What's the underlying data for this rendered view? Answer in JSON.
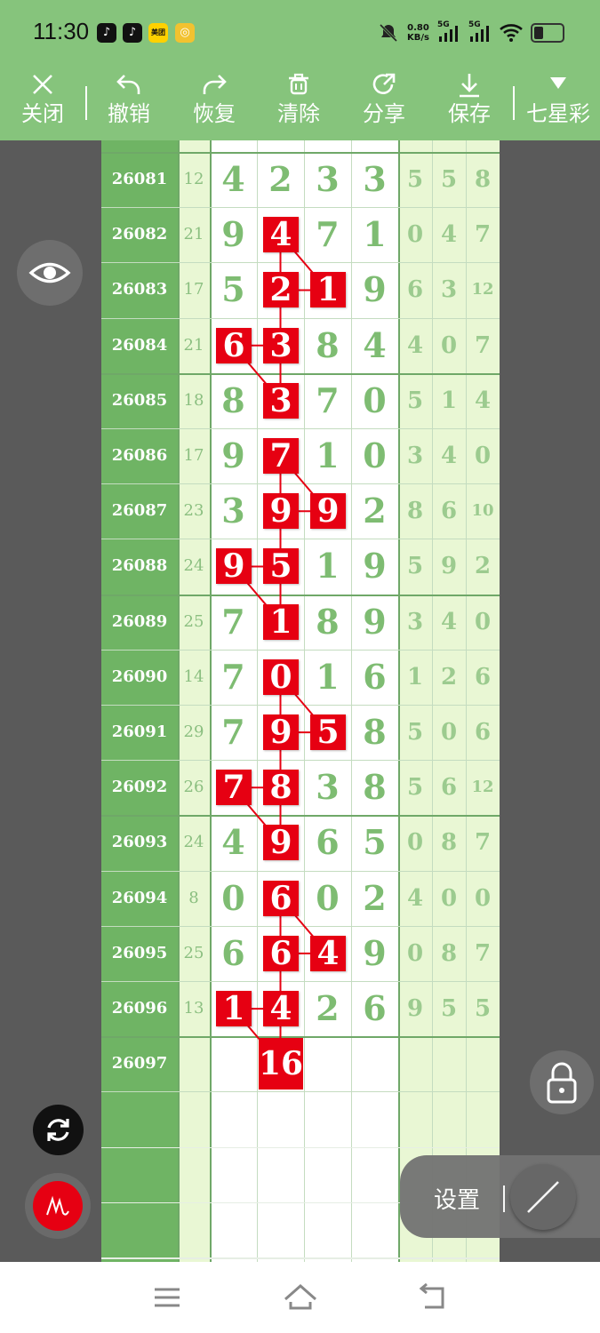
{
  "status_bar": {
    "time": "11:30",
    "app_icons": [
      "tiktok-icon",
      "tiktok-icon",
      "meituan-icon",
      "notification-icon"
    ],
    "meituan_label": "美团",
    "net_speed_value": "0.80",
    "net_speed_unit": "KB/s",
    "signal_1": "5G",
    "signal_2": "5G"
  },
  "toolbar": {
    "items": [
      {
        "label": "关闭",
        "icon": "close-icon"
      },
      {
        "label": "撤销",
        "icon": "undo-icon"
      },
      {
        "label": "恢复",
        "icon": "redo-icon"
      },
      {
        "label": "清除",
        "icon": "trash-icon"
      },
      {
        "label": "分享",
        "icon": "share-icon"
      },
      {
        "label": "保存",
        "icon": "download-icon"
      },
      {
        "label": "七星彩",
        "icon": "dropdown-triangle-icon"
      }
    ]
  },
  "chart": {
    "rows": [
      {
        "id": "26081",
        "sum": "12",
        "digits": [
          "4",
          "2",
          "3",
          "3"
        ],
        "tails": [
          "5",
          "5",
          "8"
        ]
      },
      {
        "id": "26082",
        "sum": "21",
        "digits": [
          "9",
          "4",
          "7",
          "1"
        ],
        "tails": [
          "0",
          "4",
          "7"
        ]
      },
      {
        "id": "26083",
        "sum": "17",
        "digits": [
          "5",
          "2",
          "1",
          "9"
        ],
        "tails": [
          "6",
          "3",
          "12"
        ]
      },
      {
        "id": "26084",
        "sum": "21",
        "digits": [
          "6",
          "3",
          "8",
          "4"
        ],
        "tails": [
          "4",
          "0",
          "7"
        ]
      },
      {
        "id": "26085",
        "sum": "18",
        "digits": [
          "8",
          "3",
          "7",
          "0"
        ],
        "tails": [
          "5",
          "1",
          "4"
        ]
      },
      {
        "id": "26086",
        "sum": "17",
        "digits": [
          "9",
          "7",
          "1",
          "0"
        ],
        "tails": [
          "3",
          "4",
          "0"
        ]
      },
      {
        "id": "26087",
        "sum": "23",
        "digits": [
          "3",
          "9",
          "9",
          "2"
        ],
        "tails": [
          "8",
          "6",
          "10"
        ]
      },
      {
        "id": "26088",
        "sum": "24",
        "digits": [
          "9",
          "5",
          "1",
          "9"
        ],
        "tails": [
          "5",
          "9",
          "2"
        ]
      },
      {
        "id": "26089",
        "sum": "25",
        "digits": [
          "7",
          "1",
          "8",
          "9"
        ],
        "tails": [
          "3",
          "4",
          "0"
        ]
      },
      {
        "id": "26090",
        "sum": "14",
        "digits": [
          "7",
          "0",
          "1",
          "6"
        ],
        "tails": [
          "1",
          "2",
          "6"
        ]
      },
      {
        "id": "26091",
        "sum": "29",
        "digits": [
          "7",
          "9",
          "5",
          "8"
        ],
        "tails": [
          "5",
          "0",
          "6"
        ]
      },
      {
        "id": "26092",
        "sum": "26",
        "digits": [
          "7",
          "8",
          "3",
          "8"
        ],
        "tails": [
          "5",
          "6",
          "12"
        ]
      },
      {
        "id": "26093",
        "sum": "24",
        "digits": [
          "4",
          "9",
          "6",
          "5"
        ],
        "tails": [
          "0",
          "8",
          "7"
        ]
      },
      {
        "id": "26094",
        "sum": "8",
        "digits": [
          "0",
          "6",
          "0",
          "2"
        ],
        "tails": [
          "4",
          "0",
          "0"
        ]
      },
      {
        "id": "26095",
        "sum": "25",
        "digits": [
          "6",
          "6",
          "4",
          "9"
        ],
        "tails": [
          "0",
          "8",
          "7"
        ]
      },
      {
        "id": "26096",
        "sum": "13",
        "digits": [
          "1",
          "4",
          "2",
          "6"
        ],
        "tails": [
          "9",
          "5",
          "5"
        ]
      },
      {
        "id": "26097",
        "sum": "",
        "digits": [
          "",
          "16",
          "",
          ""
        ],
        "tails": [
          "",
          "",
          ""
        ]
      }
    ],
    "highlights": [
      [
        1,
        1
      ],
      [
        2,
        1
      ],
      [
        2,
        2
      ],
      [
        3,
        0
      ],
      [
        3,
        1
      ],
      [
        4,
        1
      ],
      [
        5,
        1
      ],
      [
        6,
        1
      ],
      [
        6,
        2
      ],
      [
        7,
        0
      ],
      [
        7,
        1
      ],
      [
        8,
        1
      ],
      [
        9,
        1
      ],
      [
        10,
        1
      ],
      [
        10,
        2
      ],
      [
        11,
        0
      ],
      [
        11,
        1
      ],
      [
        12,
        1
      ],
      [
        13,
        1
      ],
      [
        14,
        1
      ],
      [
        14,
        2
      ],
      [
        15,
        0
      ],
      [
        15,
        1
      ]
    ],
    "prediction": "16",
    "highlight_color": "#e60012"
  },
  "floating": {
    "settings_label": "设置"
  }
}
